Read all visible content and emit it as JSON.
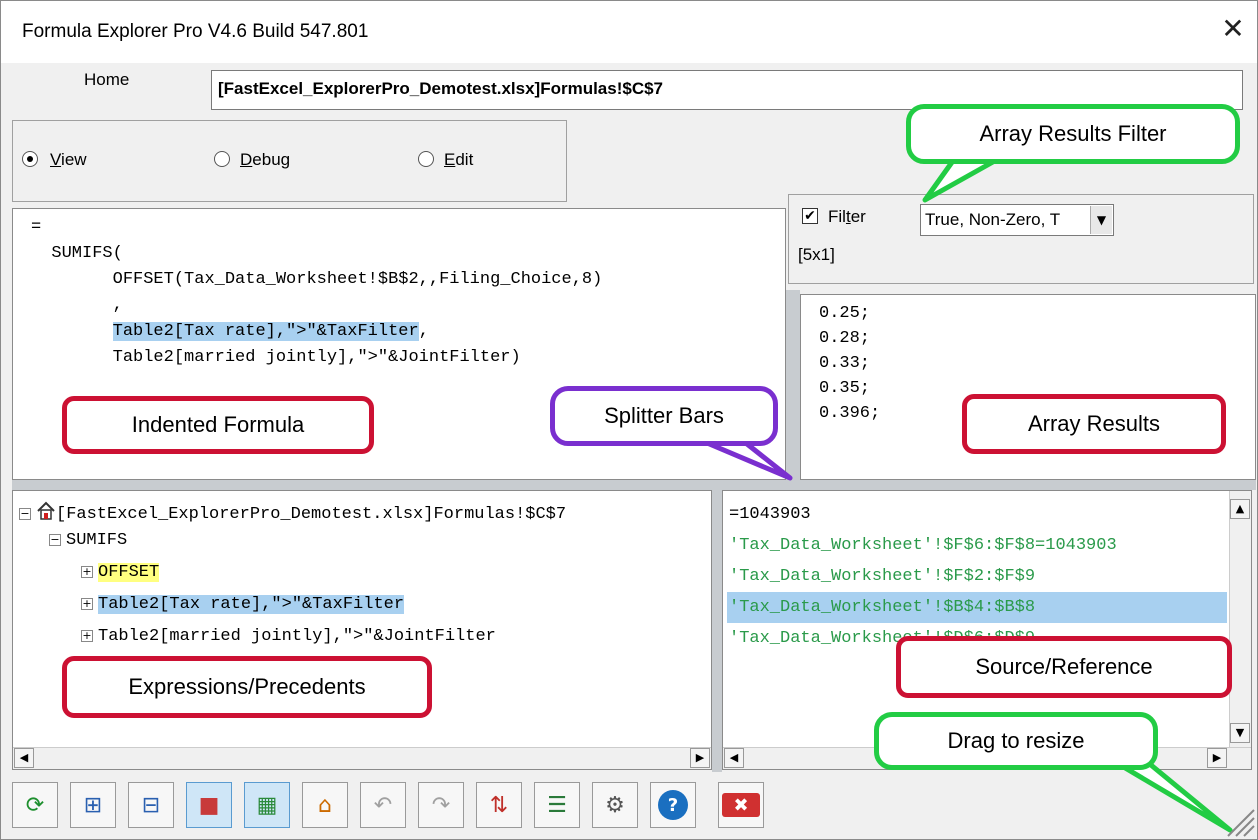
{
  "window": {
    "title": "Formula Explorer Pro V4.6 Build 547.801",
    "close_glyph": "✕"
  },
  "home": {
    "label": "Home",
    "address": "[FastExcel_ExplorerPro_Demotest.xlsx]Formulas!$C$7"
  },
  "modes": [
    {
      "label_first": "V",
      "label_rest": "iew",
      "selected": true
    },
    {
      "label_first": "D",
      "label_rest": "ebug",
      "selected": false
    },
    {
      "label_first": "E",
      "label_rest": "dit",
      "selected": false
    }
  ],
  "filter": {
    "label_a": "Fil",
    "label_u": "t",
    "label_b": "er",
    "checked": true,
    "check_glyph": "✔",
    "selected": "True, Non-Zero, T",
    "dims": "[5x1]"
  },
  "formula_lines": [
    {
      "indent": "",
      "text": "="
    },
    {
      "indent": "  ",
      "text": "SUMIFS("
    },
    {
      "indent": "        ",
      "text": "OFFSET(Tax_Data_Worksheet!$B$2,,Filing_Choice,8)"
    },
    {
      "indent": "        ",
      "text": ","
    },
    {
      "indent": "        ",
      "text": "Table2[Tax rate],\">\"&TaxFilter",
      "highlight": true,
      "tail": ","
    },
    {
      "indent": "        ",
      "text": "Table2[married jointly],\">\"&JointFilter)"
    }
  ],
  "array_results": [
    "0.25;",
    "0.28;",
    "0.33;",
    "0.35;",
    "0.396;"
  ],
  "tree": {
    "root": "[FastExcel_ExplorerPro_Demotest.xlsx]Formulas!$C$7",
    "func": "SUMIFS",
    "children": [
      "OFFSET",
      "Table2[Tax rate],\">\"&TaxFilter",
      "Table2[married jointly],\">\"&JointFilter"
    ]
  },
  "sources": [
    "=1043903",
    "'Tax_Data_Worksheet'!$F$6:$F$8=1043903",
    "'Tax_Data_Worksheet'!$F$2:$F$9",
    "'Tax_Data_Worksheet'!$B$4:$B$8",
    "'Tax_Data_Worksheet'!$D$6:$D$9"
  ],
  "callouts": {
    "array_filter": "Array Results Filter",
    "indented": "Indented Formula",
    "splitter": "Splitter Bars",
    "array_results": "Array Results",
    "expressions": "Expressions/Precedents",
    "source": "Source/Reference",
    "drag": "Drag to resize"
  },
  "colors": {
    "callout_red": "#cc1133",
    "callout_green": "#22cc44",
    "callout_purple": "#7a2fcf",
    "highlight": "#a8d0f0",
    "source_green": "#2a9a4a"
  },
  "scroll": {
    "left": "◀",
    "right": "▶",
    "up": "▲",
    "down": "▼"
  },
  "toolbar": [
    {
      "name": "refresh-icon",
      "glyph": "⟳",
      "color": "#1e8f2e"
    },
    {
      "name": "expand-icon",
      "glyph": "⊞",
      "color": "#2a60b0"
    },
    {
      "name": "collapse-icon",
      "glyph": "⊟",
      "color": "#2a60b0"
    },
    {
      "name": "color-grid-icon",
      "glyph": "■",
      "color": "#c83a3a",
      "active": true
    },
    {
      "name": "filter-grid-icon",
      "glyph": "▦",
      "color": "#2a8a3a",
      "active": true
    },
    {
      "name": "home-icon",
      "glyph": "⌂",
      "color": "#cc6a00"
    },
    {
      "name": "undo-icon",
      "glyph": "↶",
      "color": "#a0a0a0"
    },
    {
      "name": "redo-icon",
      "glyph": "↷",
      "color": "#a0a0a0"
    },
    {
      "name": "sort-icon",
      "glyph": "⇅",
      "color": "#c0302a"
    },
    {
      "name": "align-icon",
      "glyph": "☰",
      "color": "#2a7a3a"
    },
    {
      "name": "gear-icon",
      "glyph": "⚙",
      "color": "#555555"
    },
    {
      "name": "help-icon",
      "glyph": "?",
      "color": "#ffffff",
      "bg": "#1a6fc0"
    },
    {
      "name": "exit-icon",
      "glyph": "✖",
      "color": "#ffffff",
      "bg": "#d03030"
    }
  ]
}
